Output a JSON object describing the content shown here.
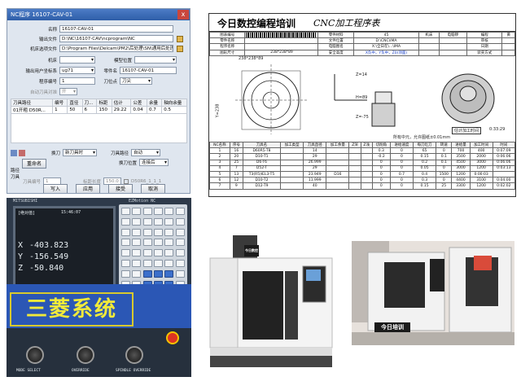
{
  "nc_dialog": {
    "title": "NC程序  16107-CAV-01",
    "close_label": "x",
    "fields": {
      "name_label": "名称",
      "name_value": "16107-CAV-01",
      "output_file_label": "输出文件",
      "output_file_value": "D:\\NC\\16107-CAV\\ncprogram\\NC",
      "machine_file_label": "机床选项文件",
      "machine_file_value": "D:\\Program Files\\Delcam\\PM2\\后处理\\SN\\通用后处理.opt",
      "machine_label": "机床",
      "model_label": "模型位置",
      "user_coord_label": "输出用户坐标系",
      "user_coord_value": "ug71",
      "part_label": "零件名",
      "part_value": "16107-CAV-01",
      "prog_no_label": "程序编号",
      "prog_no_value": "1",
      "tool_pos_label": "刀位点",
      "tool_pos_value": "刀尖",
      "auto_tool_label": "自动刀具对准",
      "auto_tool_value": "开"
    },
    "table": {
      "headers": [
        "刀具路径",
        "编号",
        "直径",
        "刀...",
        "标距",
        "估计",
        "公差",
        "余量",
        "轴向余量"
      ],
      "rows": [
        [
          "01开粗 D50R...",
          "1",
          "50",
          "6",
          "150",
          "29.22",
          "0.04",
          "0.7",
          "0.5"
        ]
      ]
    },
    "tool_change_label": "换刀",
    "tool_change_value": "新刀具时",
    "tool_output_label": "刀具路径",
    "tool_output_value": "自动",
    "rename_button": "重命名",
    "path_label": "路径",
    "tool_label": "刀具",
    "connection_label": "换刀位置",
    "connection_value": "连接后",
    "tool_no_label": "刀具编号",
    "tool_no_value": "1",
    "gauge_label": "标距长度",
    "gauge_value": "150.0",
    "tool_name_value": "D50R6_1_1_1",
    "write_button": "写入",
    "apply_button": "应用",
    "accept_button": "接受",
    "cancel_button": "取消"
  },
  "process_sheet": {
    "brand": "今日数控编程培训",
    "title": "CNC加工程序表",
    "rows_top": [
      [
        "图表编号",
        "",
        "零件材料",
        "45",
        "机床",
        "电脑锣",
        "编程",
        "黄"
      ],
      [
        "零件名称",
        "",
        "文件位置",
        "D:\\CNC\\IMA",
        "",
        "",
        "审核",
        ""
      ],
      [
        "程序名称",
        "",
        "电脑图名",
        "X:\\全日在\\...\\IMA",
        "",
        "",
        "日期",
        ""
      ],
      [
        "图形尺寸",
        "238*238*89",
        "安全高度",
        "X负中，Y负中，Z0(顶面)",
        "",
        "",
        "装夹方式",
        ""
      ]
    ],
    "dims": {
      "x": "X= 238",
      "y": "Y=238",
      "size": "238*238*89",
      "z_top": "Z=14",
      "z_bottom": "Z=-75",
      "h": "H=89"
    },
    "time_label": "估计加工时间",
    "time_value": "0:33:29",
    "note": "所有中元，允许图纸±0.01mm",
    "table_headers": [
      "NC名称",
      "序号",
      "刀具名",
      "加工类型",
      "刀具直径",
      "加工余量",
      "Z深",
      "Z浅",
      "切削角",
      "进给速度",
      "每刀吃刀",
      "转速",
      "进给量",
      "加工时间",
      "时间"
    ],
    "table_rows": [
      [
        "1",
        "16",
        "D60R5-T8",
        "",
        "14",
        "",
        "",
        "",
        "0.3",
        "0",
        "65",
        "0",
        "700",
        "400",
        "0:07:09"
      ],
      [
        "2",
        "20",
        "D10-T1",
        "",
        "29",
        "",
        "",
        "",
        "-0.2",
        "0",
        "0.15",
        "0.1",
        "3500",
        "2000",
        "0:06:06"
      ],
      [
        "3",
        "25",
        "D6-T6",
        "",
        "26.999",
        "",
        "",
        "",
        "0",
        "0",
        "0.2",
        "0.1",
        "4500",
        "3000",
        "0:06:06"
      ],
      [
        "4",
        "7",
        "D52-T",
        "",
        "29",
        "",
        "",
        "",
        "0",
        "0",
        "0.05",
        "0",
        "3000",
        "1200",
        "0:03:13"
      ],
      [
        "5",
        "13",
        "T3(R5)IEL3-T5",
        "",
        "23.949",
        "D16",
        "",
        "",
        "0",
        "0.7",
        "0.4",
        "1500",
        "1200",
        "0:00:03",
        ""
      ],
      [
        "6",
        "12",
        "D10-T2",
        "",
        "11.999",
        "",
        "",
        "",
        "0",
        "0",
        "0.3",
        "0",
        "4400",
        "3100",
        "0:04:00"
      ],
      [
        "7",
        "9",
        "D12-T9",
        "",
        "40",
        "",
        "",
        "",
        "0",
        "0",
        "0.15",
        "25",
        "3300",
        "1200",
        "0:02:02"
      ]
    ]
  },
  "controller": {
    "brand": "MITSUBISHI",
    "model_label": "EZMotion NC",
    "banner": "三菱系统",
    "screen_header": "[绝对值]",
    "screen_time": "15:46:07",
    "axes": [
      {
        "name": "X",
        "value": "-403.823"
      },
      {
        "name": "Y",
        "value": "-156.549"
      },
      {
        "name": "Z",
        "value": "-50.840"
      }
    ],
    "mode_label": "MODE SELECT",
    "override_label": "OVERRIDE",
    "spindle_label": "SPINDLE OVERRIDE"
  },
  "machine_photos": {
    "sign_left": "今日数控",
    "sign_right": "今日培训"
  }
}
